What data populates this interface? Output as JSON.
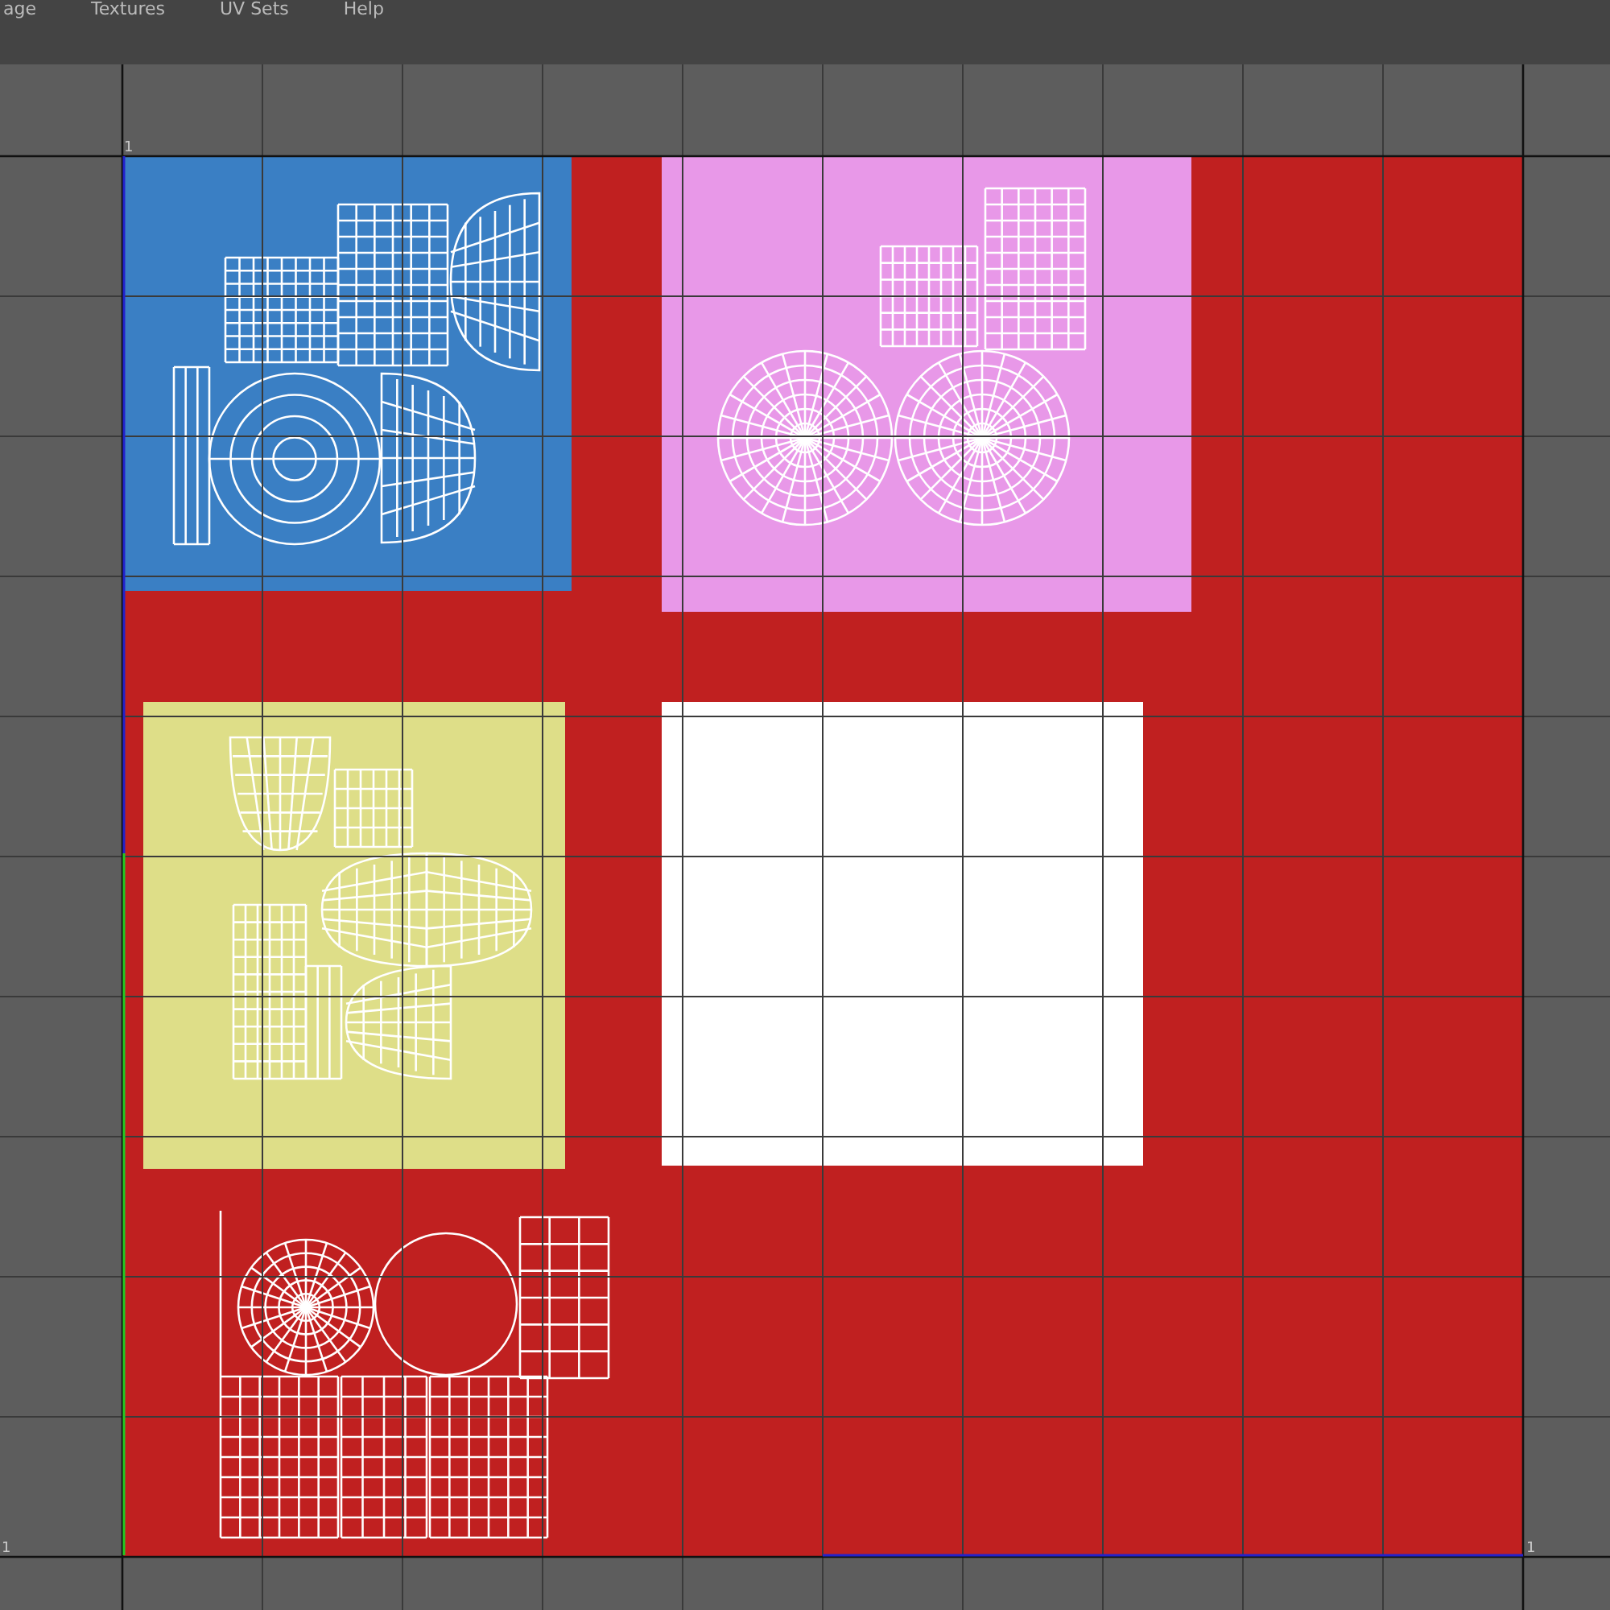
{
  "menu": [
    "age",
    "Textures",
    "UV Sets",
    "Help"
  ],
  "axis_labels": [
    {
      "label": "1",
      "kind": "top"
    },
    {
      "label": "1",
      "kind": "left"
    },
    {
      "label": "1",
      "kind": "right"
    }
  ],
  "shells": [
    {
      "kind": "mesh",
      "color": "#3a7fc4"
    },
    {
      "kind": "mesh",
      "color": "#e898e8"
    },
    {
      "kind": "mesh",
      "color": "#dede88"
    },
    {
      "kind": "solid",
      "color": "#ffffff"
    },
    {
      "kind": "wire"
    }
  ]
}
